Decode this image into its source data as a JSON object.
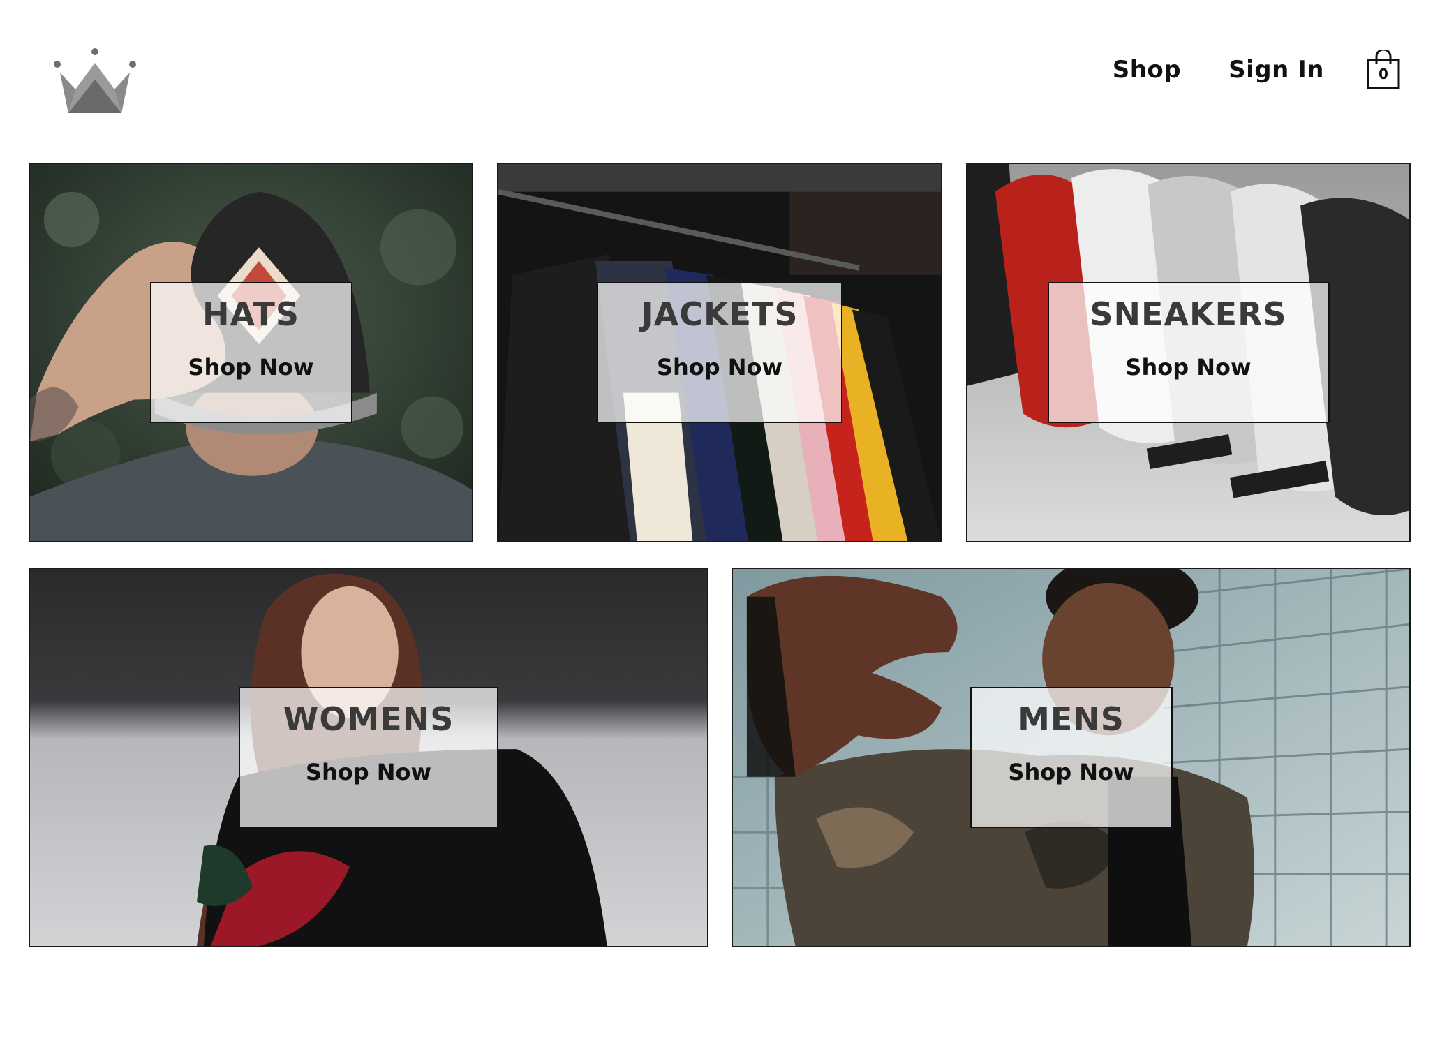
{
  "header": {
    "logo": {
      "icon": "crown-icon",
      "color": "#7a7a7a"
    },
    "nav": {
      "shop_label": "Shop",
      "signin_label": "Sign In"
    },
    "cart": {
      "icon": "shopping-bag-icon",
      "count": "0"
    }
  },
  "categories": [
    {
      "title": "HATS",
      "cta": "Shop Now",
      "image": "hats-photo"
    },
    {
      "title": "JACKETS",
      "cta": "Shop Now",
      "image": "jackets-photo"
    },
    {
      "title": "SNEAKERS",
      "cta": "Shop Now",
      "image": "sneakers-photo"
    },
    {
      "title": "WOMENS",
      "cta": "Shop Now",
      "image": "womens-photo"
    },
    {
      "title": "MENS",
      "cta": "Shop Now",
      "image": "mens-photo"
    }
  ]
}
